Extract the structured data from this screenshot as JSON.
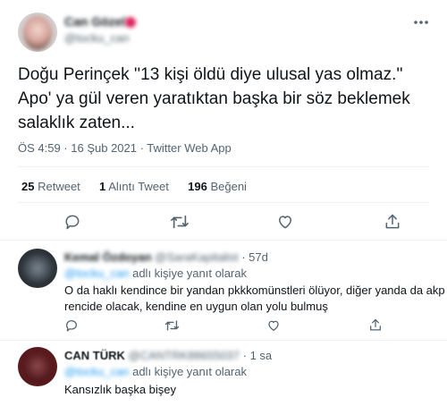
{
  "main_tweet": {
    "author_name": "Can Gözel",
    "author_handle": "@tocku_can",
    "text_lines": [
      "Doğu Perinçek ''13 kişi öldü diye ulusal yas olmaz.''",
      "Apo' ya gül veren yaratıktan başka bir söz beklemek",
      "salaklık zaten..."
    ],
    "meta": "ÖS 4:59 · 16 Şub 2021 · Twitter Web App",
    "stats": {
      "retweets_count": "25",
      "retweets_label": "Retweet",
      "quotes_count": "1",
      "quotes_label": "Alıntı Tweet",
      "likes_count": "196",
      "likes_label": "Beğeni"
    }
  },
  "replies": [
    {
      "name": "Kemal Özdoyan",
      "handle": "@SaraKapitalist",
      "sep": "·",
      "time": "57d",
      "reply_handle": "@tocku_can",
      "reply_suffix": "adlı kişiye yanıt olarak",
      "text_lines": [
        "O da haklı kendince bir yandan pkkkomünstleri ölüyor, diğer yanda da akp",
        "rencide olacak,  kendine en uygun olan yolu bulmuş"
      ]
    },
    {
      "name": "CAN TÜRK",
      "handle": "@CANTRK88655037",
      "sep": "·",
      "time": "1 sa",
      "reply_handle": "@tocku_can",
      "reply_suffix": "adlı kişiye yanıt olarak",
      "text_lines": [
        "Kansızlık başka bişey"
      ]
    }
  ],
  "icons": [
    "reply-icon",
    "retweet-icon",
    "like-icon",
    "share-icon",
    "more-icon"
  ],
  "colors": {
    "accent": "#1d9bf0",
    "muted": "#536471",
    "divider": "#eff3f4"
  }
}
